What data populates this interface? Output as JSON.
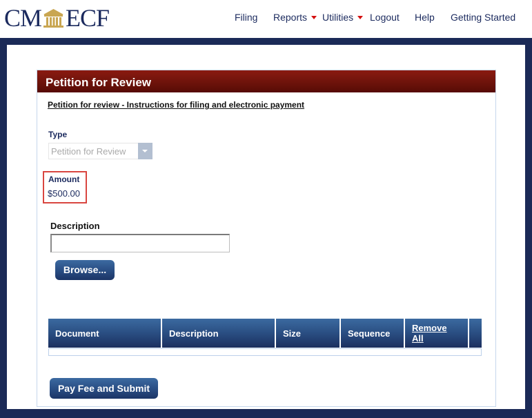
{
  "header": {
    "logo": {
      "left_text": "CM",
      "right_text": "ECF",
      "emblem": "courthouse-icon"
    },
    "nav": [
      {
        "label": "Filing",
        "has_dropdown": false
      },
      {
        "label": "Reports",
        "has_dropdown": true
      },
      {
        "label": "Utilities",
        "has_dropdown": true
      },
      {
        "label": "Logout",
        "has_dropdown": false
      },
      {
        "label": "Help",
        "has_dropdown": false
      },
      {
        "label": "Getting Started",
        "has_dropdown": false
      }
    ]
  },
  "panel": {
    "title": "Petition for Review",
    "instructions_link": "Petition for review - Instructions for filing and electronic payment",
    "type": {
      "label": "Type",
      "value": "Petition for Review",
      "disabled": true
    },
    "amount": {
      "label": "Amount",
      "value": "$500.00"
    },
    "description": {
      "label": "Description",
      "value": "",
      "placeholder": ""
    },
    "browse_label": "Browse...",
    "table": {
      "columns": [
        "Document",
        "Description",
        "Size",
        "Sequence"
      ],
      "remove_all_line1": "Remove",
      "remove_all_line2": "All",
      "rows": []
    },
    "submit_label": "Pay Fee and Submit"
  },
  "colors": {
    "brand_navy": "#1b2a57",
    "header_red": "#7a160c",
    "button_blue": "#2a4f85",
    "highlight_red": "#d9453f",
    "dropdown_caret": "#d41010",
    "logo_gold": "#c9a652"
  }
}
